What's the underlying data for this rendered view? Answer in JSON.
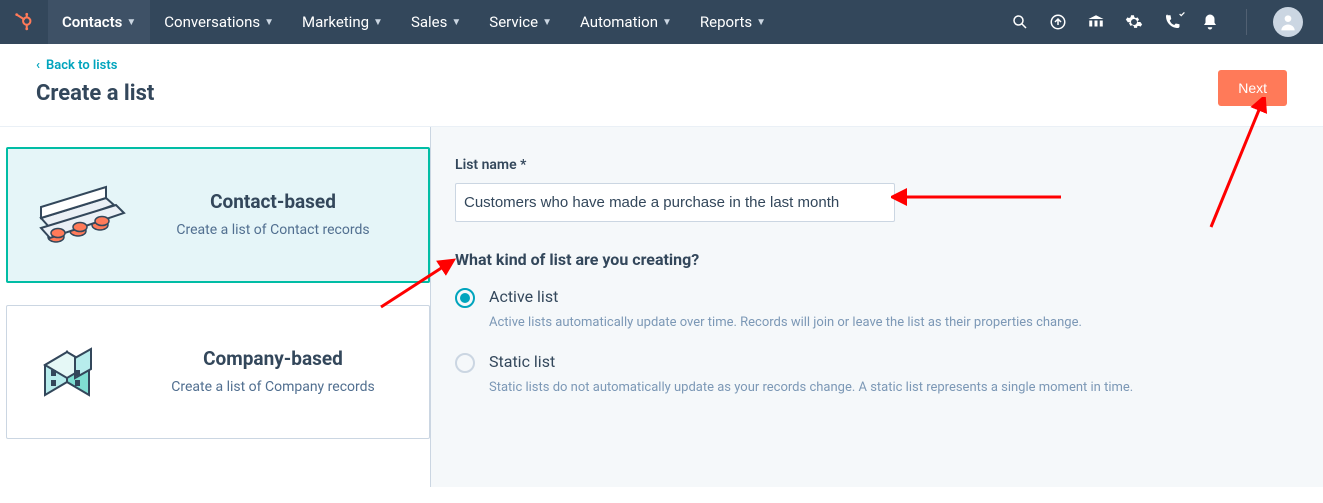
{
  "nav": {
    "items": [
      {
        "label": "Contacts",
        "active": true
      },
      {
        "label": "Conversations"
      },
      {
        "label": "Marketing"
      },
      {
        "label": "Sales"
      },
      {
        "label": "Service"
      },
      {
        "label": "Automation"
      },
      {
        "label": "Reports"
      }
    ]
  },
  "header": {
    "back_label": "Back to lists",
    "title": "Create a list",
    "next_label": "Next"
  },
  "cards": {
    "contact": {
      "title": "Contact-based",
      "desc": "Create a list of Contact records"
    },
    "company": {
      "title": "Company-based",
      "desc": "Create a list of Company records"
    }
  },
  "form": {
    "name_label": "List name *",
    "name_value": "Customers who have made a purchase in the last month",
    "question": "What kind of list are you creating?",
    "options": {
      "active": {
        "title": "Active list",
        "desc": "Active lists automatically update over time. Records will join or leave the list as their properties change."
      },
      "static": {
        "title": "Static list",
        "desc": "Static lists do not automatically update as your records change. A static list represents a single moment in time."
      }
    }
  }
}
